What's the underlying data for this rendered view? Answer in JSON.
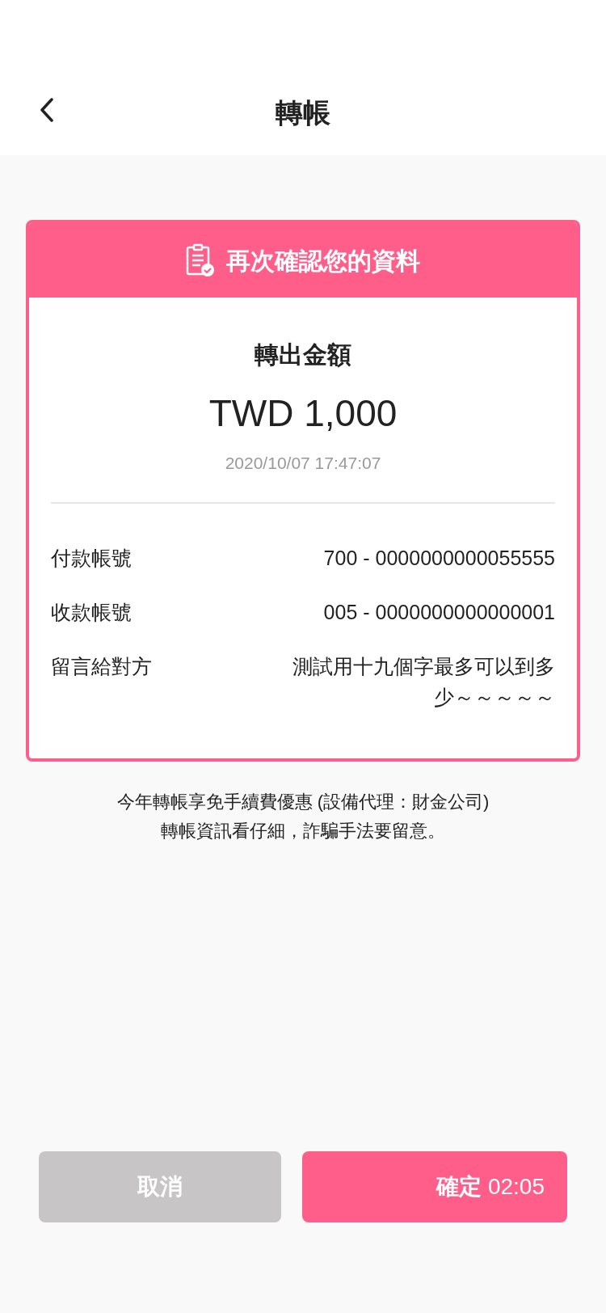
{
  "header": {
    "title": "轉帳"
  },
  "card": {
    "banner": "再次確認您的資料",
    "amount_label": "轉出金額",
    "amount": "TWD 1,000",
    "timestamp": "2020/10/07 17:47:07",
    "rows": [
      {
        "label": "付款帳號",
        "value": "700 - 0000000000055555"
      },
      {
        "label": "收款帳號",
        "value": "005 - 0000000000000001"
      },
      {
        "label": "留言給對方",
        "value": "測試用十九個字最多可以到多少～～～～～"
      }
    ]
  },
  "notes": [
    "今年轉帳享免手續費優惠 (設備代理：財金公司)",
    "轉帳資訊看仔細，詐騙手法要留意。"
  ],
  "buttons": {
    "cancel": "取消",
    "confirm": "確定",
    "countdown": "02:05"
  }
}
